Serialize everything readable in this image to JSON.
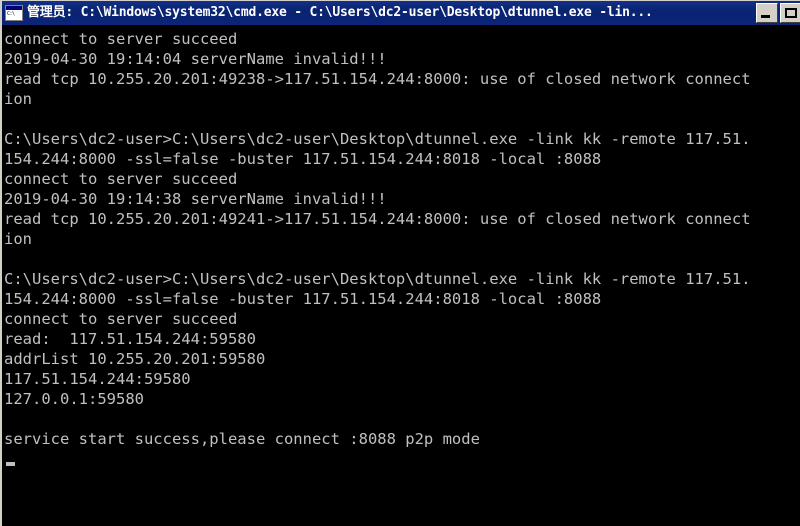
{
  "window": {
    "title": "管理员: C:\\Windows\\system32\\cmd.exe - C:\\Users\\dc2-user\\Desktop\\dtunnel.exe  -lin...",
    "icon_label": "C:\\",
    "icon_name": "cmd-console-icon",
    "titlebar_color": "#0a2371",
    "titlebar_text_color": "#ffffff",
    "buttons": {
      "minimize_label": "Minimize",
      "maximize_label": "Maximize"
    }
  },
  "console": {
    "background_color": "#000000",
    "text_color": "#c0c0c0",
    "columns": 80,
    "cursor_visible": true,
    "lines": [
      "connect to server succeed",
      "2019-04-30 19:14:04 serverName invalid!!!",
      "read tcp 10.255.20.201:49238->117.51.154.244:8000: use of closed network connect",
      "ion",
      "",
      "C:\\Users\\dc2-user>C:\\Users\\dc2-user\\Desktop\\dtunnel.exe -link kk -remote 117.51.",
      "154.244:8000 -ssl=false -buster 117.51.154.244:8018 -local :8088",
      "connect to server succeed",
      "2019-04-30 19:14:38 serverName invalid!!!",
      "read tcp 10.255.20.201:49241->117.51.154.244:8000: use of closed network connect",
      "ion",
      "",
      "C:\\Users\\dc2-user>C:\\Users\\dc2-user\\Desktop\\dtunnel.exe -link kk -remote 117.51.",
      "154.244:8000 -ssl=false -buster 117.51.154.244:8018 -local :8088",
      "connect to server succeed",
      "read:  117.51.154.244:59580",
      "addrList 10.255.20.201:59580",
      "117.51.154.244:59580",
      "127.0.0.1:59580",
      "",
      "service start success,please connect :8088 p2p mode"
    ]
  }
}
